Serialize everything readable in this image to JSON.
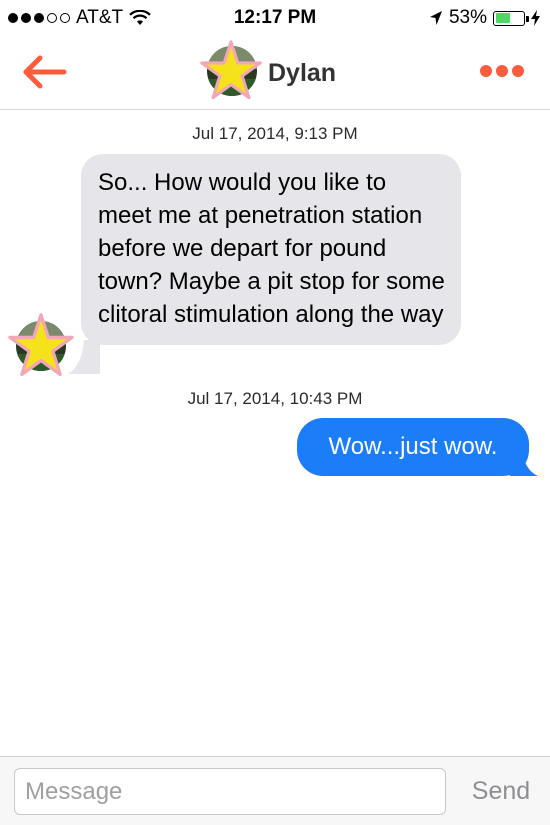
{
  "status_bar": {
    "carrier": "AT&T",
    "time": "12:17 PM",
    "battery_percent": "53%",
    "battery_level": 0.53,
    "signal_bars_filled": 3,
    "signal_bars_total": 5
  },
  "nav": {
    "contact_name": "Dylan",
    "back_icon": "back-arrow-icon",
    "more_icon": "more-dots-icon",
    "accent_color": "#fd5c3c"
  },
  "messages": [
    {
      "timestamp": "Jul 17, 2014, 9:13 PM",
      "direction": "incoming",
      "text": "So... How would you like to meet me at penetration station before we depart for pound town? Maybe a pit stop for some clitoral stimulation along the way"
    },
    {
      "timestamp": "Jul 17, 2014, 10:43 PM",
      "direction": "outgoing",
      "text": "Wow...just wow."
    }
  ],
  "composer": {
    "placeholder": "Message",
    "send_label": "Send"
  },
  "colors": {
    "incoming_bubble": "#e5e5ea",
    "outgoing_bubble": "#1b7df7",
    "battery_fill": "#4cd964"
  }
}
